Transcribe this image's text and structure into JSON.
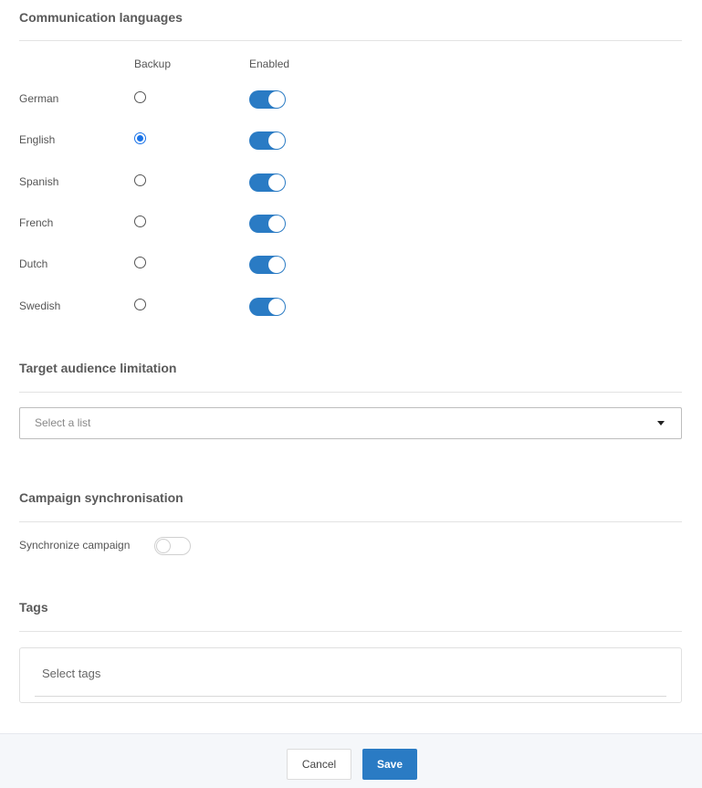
{
  "communication_languages": {
    "title": "Communication languages",
    "col_backup": "Backup",
    "col_enabled": "Enabled",
    "languages": [
      {
        "label": "German",
        "backup": false,
        "enabled": true
      },
      {
        "label": "English",
        "backup": true,
        "enabled": true
      },
      {
        "label": "Spanish",
        "backup": false,
        "enabled": true
      },
      {
        "label": "French",
        "backup": false,
        "enabled": true
      },
      {
        "label": "Dutch",
        "backup": false,
        "enabled": true
      },
      {
        "label": "Swedish",
        "backup": false,
        "enabled": true
      }
    ]
  },
  "target_audience": {
    "title": "Target audience limitation",
    "placeholder": "Select a list"
  },
  "campaign_sync": {
    "title": "Campaign synchronisation",
    "label": "Synchronize campaign",
    "enabled": false
  },
  "tags": {
    "title": "Tags",
    "placeholder": "Select tags"
  },
  "footer": {
    "cancel_label": "Cancel",
    "save_label": "Save"
  },
  "colors": {
    "accent": "#2a7bc4",
    "radio_selected": "#1a73e8"
  }
}
